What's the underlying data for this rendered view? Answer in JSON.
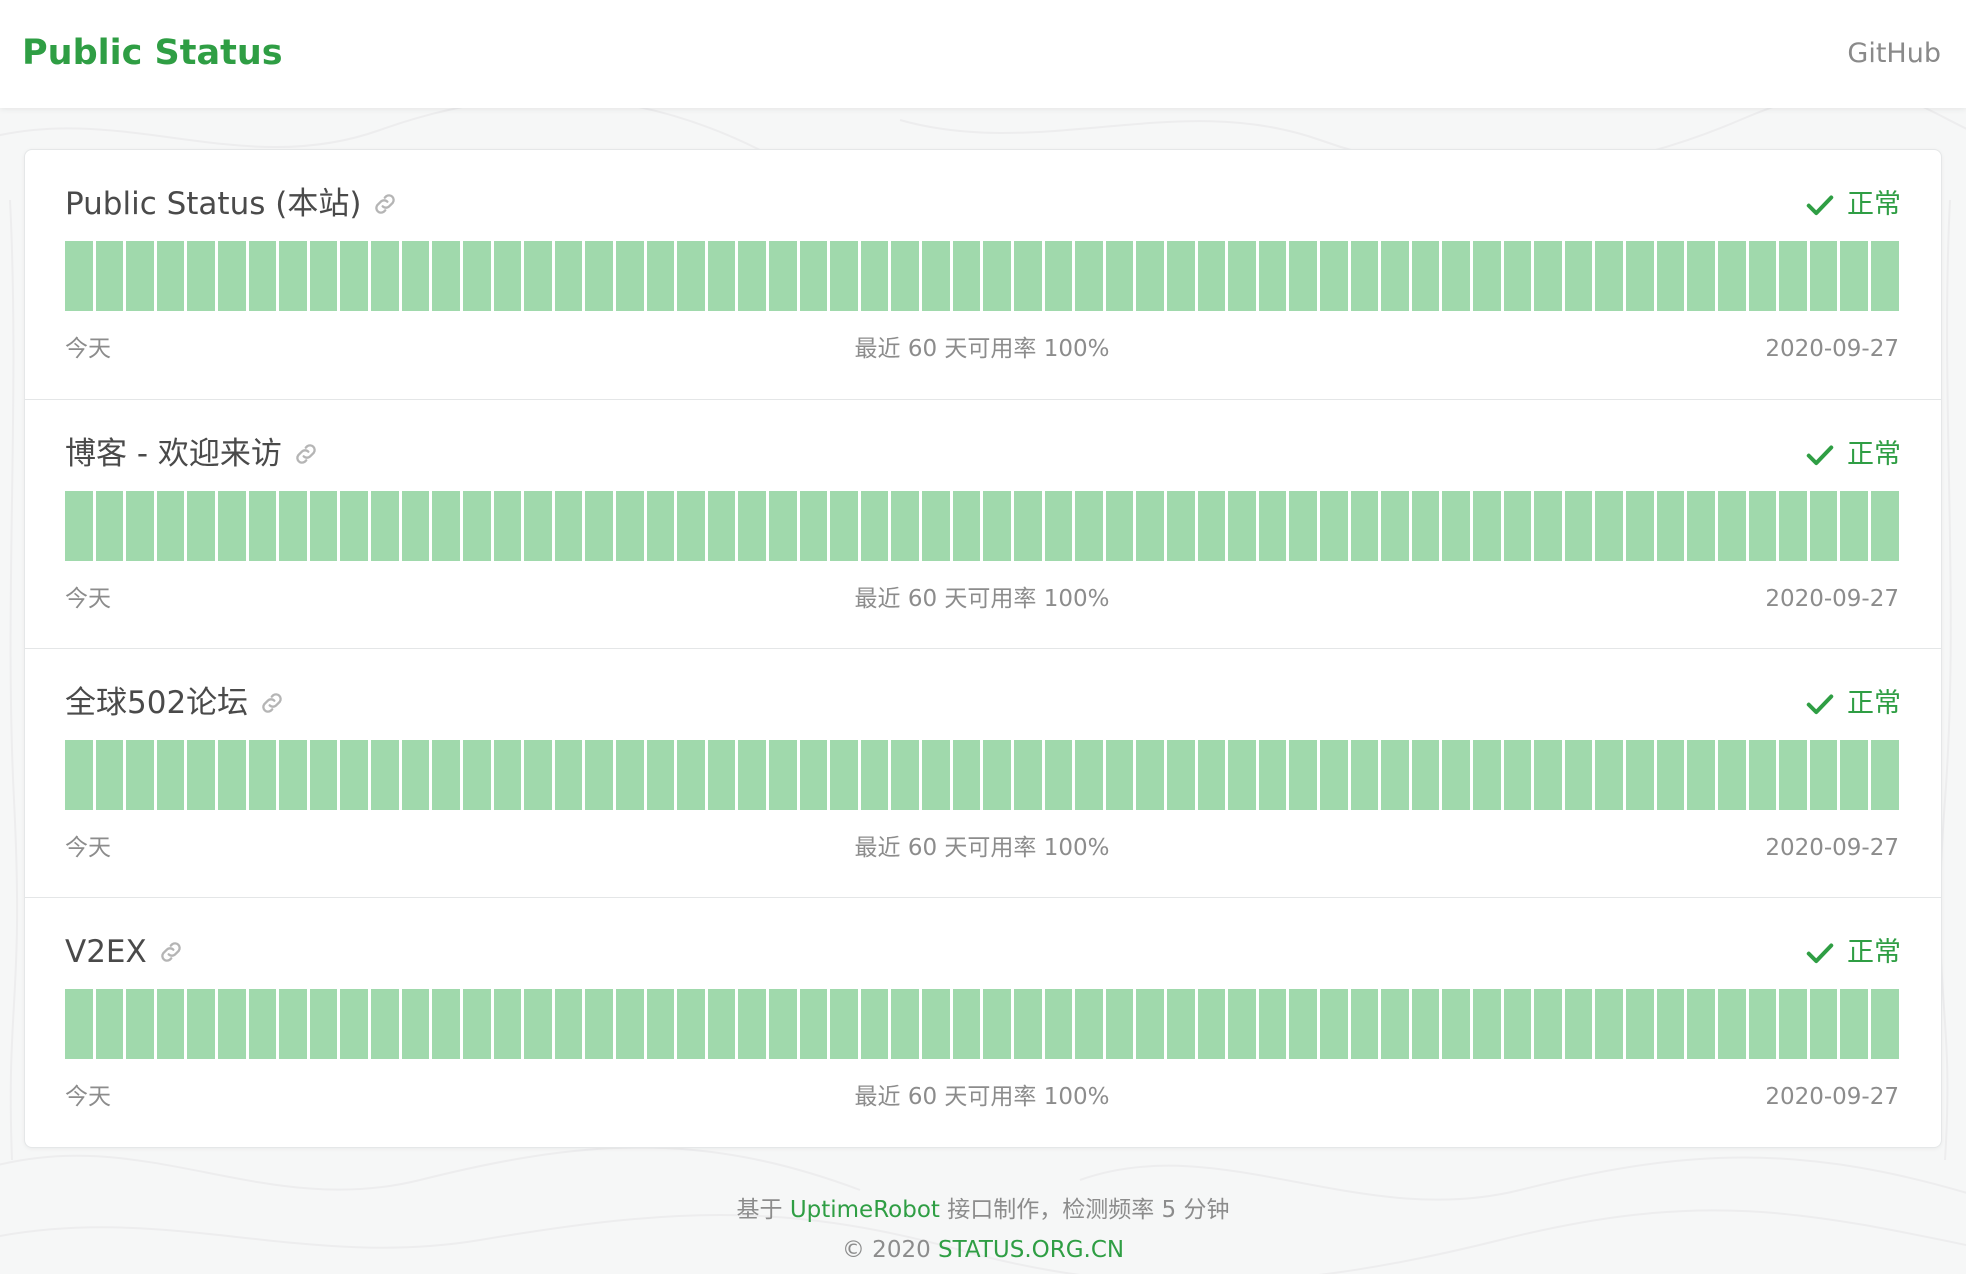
{
  "header": {
    "brand": "Public Status",
    "github_label": "GitHub"
  },
  "colors": {
    "accent": "#2f9e44",
    "bar_up": "#a0d9ac",
    "muted_text": "#8c8c8c"
  },
  "monitors": [
    {
      "name": "Public Status (本站)",
      "status": "正常",
      "status_icon": "check-icon",
      "link_icon": "link-icon",
      "days": 60,
      "left_label": "今天",
      "uptime_text": "最近 60 天可用率 100%",
      "date_label": "2020-09-27"
    },
    {
      "name": "博客 - 欢迎来访",
      "status": "正常",
      "status_icon": "check-icon",
      "link_icon": "link-icon",
      "days": 60,
      "left_label": "今天",
      "uptime_text": "最近 60 天可用率 100%",
      "date_label": "2020-09-27"
    },
    {
      "name": "全球502论坛",
      "status": "正常",
      "status_icon": "check-icon",
      "link_icon": "link-icon",
      "days": 60,
      "left_label": "今天",
      "uptime_text": "最近 60 天可用率 100%",
      "date_label": "2020-09-27"
    },
    {
      "name": "V2EX",
      "status": "正常",
      "status_icon": "check-icon",
      "link_icon": "link-icon",
      "days": 60,
      "left_label": "今天",
      "uptime_text": "最近 60 天可用率 100%",
      "date_label": "2020-09-27"
    }
  ],
  "footer": {
    "line1_prefix": "基于 ",
    "line1_link": "UptimeRobot",
    "line1_suffix": " 接口制作，检测频率 5 分钟",
    "line2_prefix": "© 2020 ",
    "line2_link": "STATUS.ORG.CN"
  }
}
